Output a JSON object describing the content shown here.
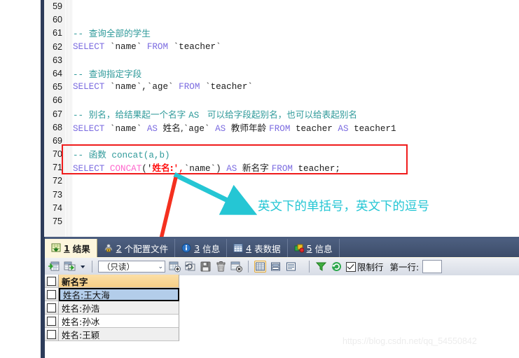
{
  "editor": {
    "first_line_number": 59,
    "lines": [
      {
        "n": 59,
        "tokens": []
      },
      {
        "n": 60,
        "tokens": []
      },
      {
        "n": 61,
        "tokens": [
          {
            "t": "-- ",
            "c": "cm"
          },
          {
            "t": "查询全部的学生",
            "c": "cm cjk"
          }
        ]
      },
      {
        "n": 62,
        "tokens": [
          {
            "t": "SELECT ",
            "c": "kw"
          },
          {
            "t": "`name` ",
            "c": "id"
          },
          {
            "t": "FROM ",
            "c": "kw"
          },
          {
            "t": "`teacher`",
            "c": "id"
          }
        ]
      },
      {
        "n": 63,
        "tokens": []
      },
      {
        "n": 64,
        "tokens": [
          {
            "t": "-- ",
            "c": "cm"
          },
          {
            "t": "查询指定字段",
            "c": "cm cjk"
          }
        ]
      },
      {
        "n": 65,
        "tokens": [
          {
            "t": "SELECT ",
            "c": "kw"
          },
          {
            "t": "`name`,`age` ",
            "c": "id"
          },
          {
            "t": "FROM ",
            "c": "kw"
          },
          {
            "t": "`teacher`",
            "c": "id"
          }
        ]
      },
      {
        "n": 66,
        "tokens": []
      },
      {
        "n": 67,
        "tokens": [
          {
            "t": "-- ",
            "c": "cm"
          },
          {
            "t": "别名，给结果起一个名字 ",
            "c": "cm cjk"
          },
          {
            "t": "AS ",
            "c": "cm"
          },
          {
            "t": " 可以给字段起别名，也可以给表起别名",
            "c": "cm cjk"
          }
        ]
      },
      {
        "n": 68,
        "tokens": [
          {
            "t": "SELECT ",
            "c": "kw"
          },
          {
            "t": "`name` ",
            "c": "id"
          },
          {
            "t": "AS ",
            "c": "kw"
          },
          {
            "t": "姓名,",
            "c": "id cjk"
          },
          {
            "t": "`age` ",
            "c": "id"
          },
          {
            "t": "AS ",
            "c": "kw"
          },
          {
            "t": "教师年龄 ",
            "c": "id cjk"
          },
          {
            "t": "FROM ",
            "c": "kw"
          },
          {
            "t": "teacher ",
            "c": "id"
          },
          {
            "t": "AS ",
            "c": "kw"
          },
          {
            "t": "teacher1",
            "c": "id"
          }
        ]
      },
      {
        "n": 69,
        "tokens": []
      },
      {
        "n": 70,
        "tokens": [
          {
            "t": "-- ",
            "c": "cm"
          },
          {
            "t": "函数",
            "c": "cm cjk"
          },
          {
            "t": " concat(a,b)",
            "c": "cm"
          }
        ]
      },
      {
        "n": 71,
        "tokens": [
          {
            "t": "SELECT ",
            "c": "kw"
          },
          {
            "t": "CONCAT",
            "c": "fn"
          },
          {
            "t": "('",
            "c": "id"
          },
          {
            "t": "姓名:",
            "c": "str cjk"
          },
          {
            "t": "',",
            "c": "str"
          },
          {
            "t": "`name`) ",
            "c": "id"
          },
          {
            "t": "AS ",
            "c": "kw"
          },
          {
            "t": "新名字 ",
            "c": "id cjk"
          },
          {
            "t": "FROM ",
            "c": "kw"
          },
          {
            "t": "teacher;",
            "c": "id"
          }
        ]
      },
      {
        "n": 72,
        "tokens": []
      },
      {
        "n": 73,
        "tokens": []
      },
      {
        "n": 74,
        "tokens": []
      },
      {
        "n": 75,
        "tokens": []
      }
    ]
  },
  "annotations": {
    "cyan_note": "英文下的单括号，英文下的逗号",
    "cyan_color": "#25c6d4",
    "red_color": "#f01c1c",
    "highlight_box_label": "red-highlight-box"
  },
  "results_panel": {
    "tabs": [
      {
        "num": "1",
        "label": "结果",
        "icon": "result-grid-icon",
        "active": true
      },
      {
        "num": "2",
        "label": "个配置文件",
        "icon": "profile-icon",
        "active": false
      },
      {
        "num": "3",
        "label": "信息",
        "icon": "info-icon",
        "active": false
      },
      {
        "num": "4",
        "label": "表数据",
        "icon": "table-data-icon",
        "active": false
      },
      {
        "num": "5",
        "label": "信息",
        "icon": "status-icon",
        "active": false
      }
    ],
    "toolbar": {
      "mode_value": "（只读）",
      "mode_caret": "⌄",
      "limit_label": "限制行",
      "limit_checked": true,
      "first_row_label": "第一行:",
      "first_row_value": "",
      "icons": [
        "add-record-icon",
        "export-record-icon",
        "dropdown-arrow-icon",
        "insert-row-icon",
        "refresh-row-icon",
        "save-icon",
        "delete-icon",
        "cancel-edit-icon",
        "grid-view-icon",
        "form-view-icon",
        "text-view-icon",
        "filter-icon",
        "refresh-icon"
      ]
    },
    "grid": {
      "columns": [
        "新名字"
      ],
      "rows": [
        {
          "value": "姓名:王大海",
          "selected": true
        },
        {
          "value": "姓名:孙浩",
          "selected": false
        },
        {
          "value": "姓名:孙冰",
          "selected": false
        },
        {
          "value": "姓名:王颖",
          "selected": false
        }
      ]
    }
  },
  "watermark": "https://blog.csdn.net/qq_54550842"
}
